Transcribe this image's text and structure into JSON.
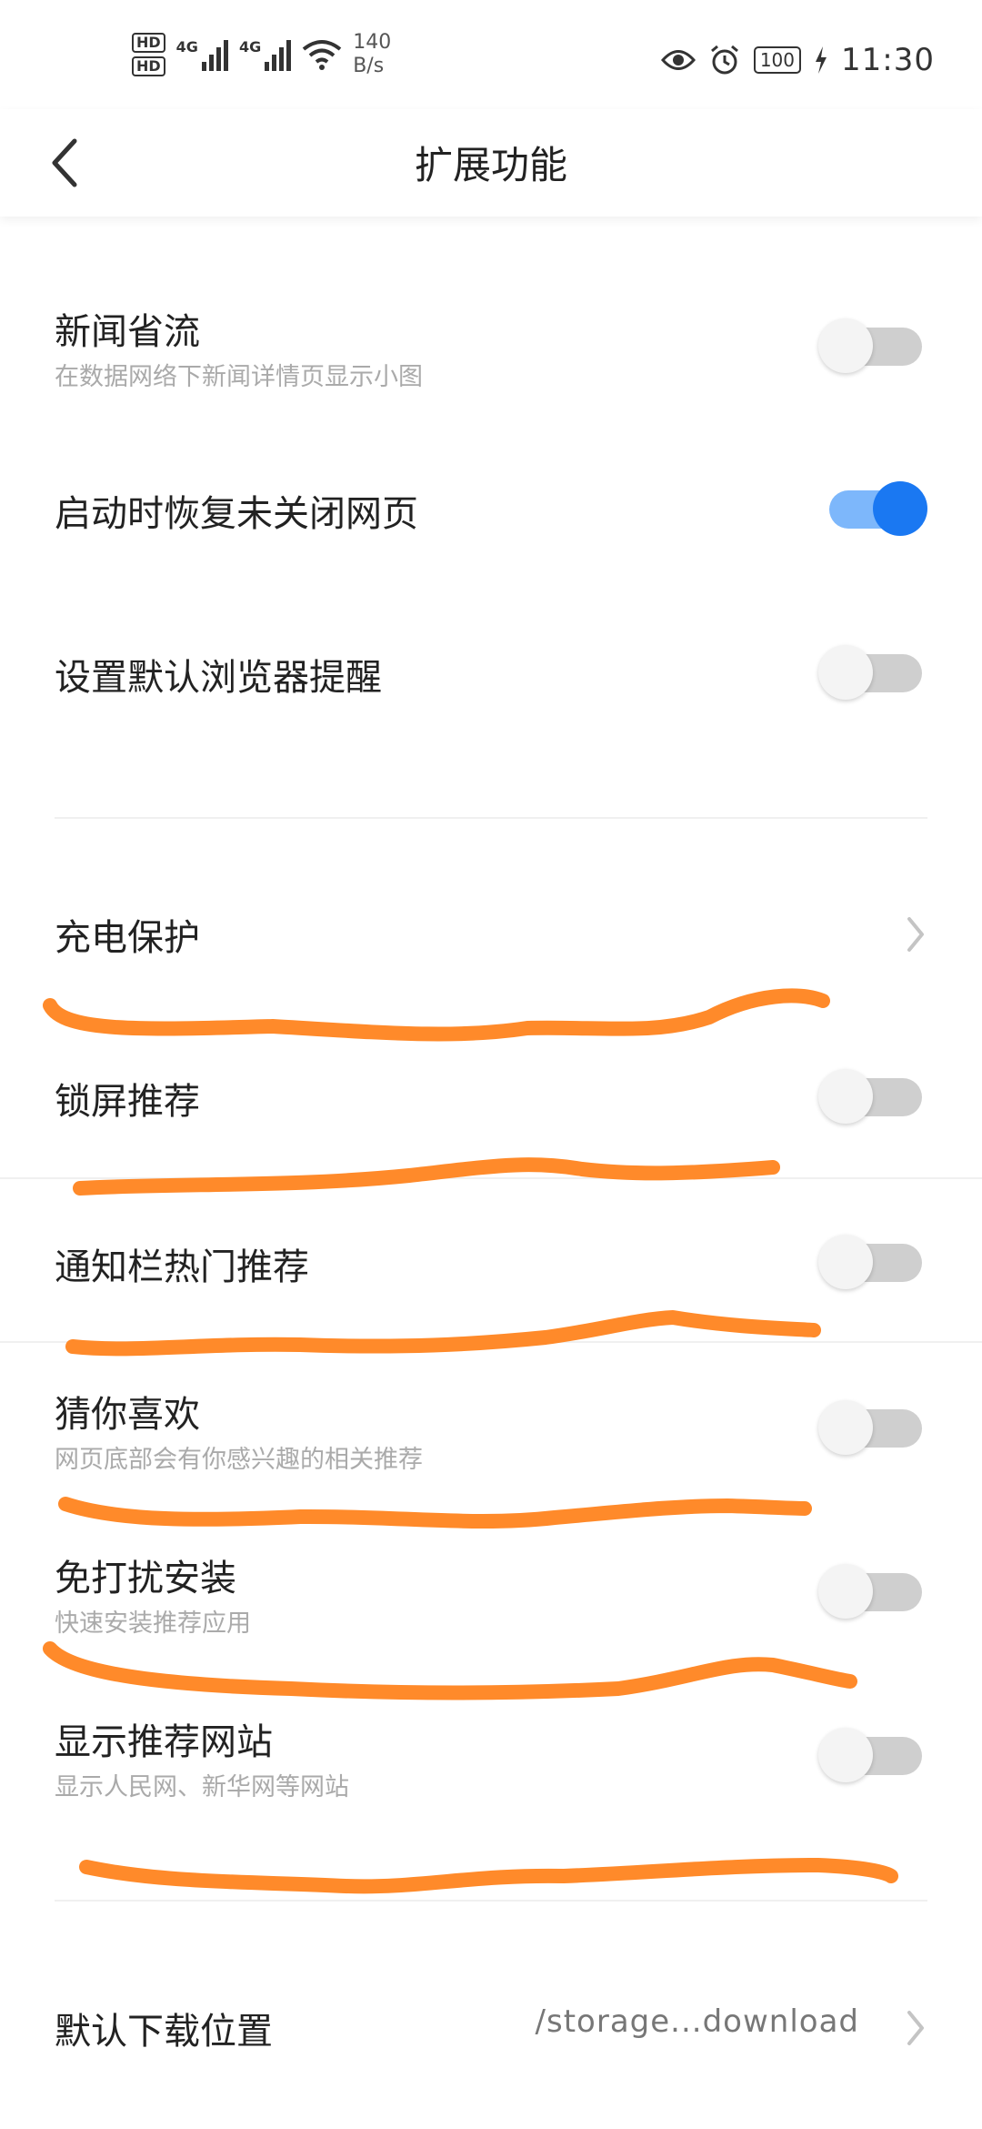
{
  "status_bar": {
    "hd1": "HD",
    "hd2": "HD",
    "sig1": "4G",
    "sig2": "4G",
    "net_speed_value": "140",
    "net_speed_unit": "B/s",
    "battery": "100",
    "time": "11:30"
  },
  "header": {
    "title": "扩展功能"
  },
  "settings": [
    {
      "label": "新闻省流",
      "sub": "在数据网络下新闻详情页显示小图",
      "on": false
    },
    {
      "label": "启动时恢复未关闭网页",
      "sub": "",
      "on": true
    },
    {
      "label": "设置默认浏览器提醒",
      "sub": "",
      "on": false
    },
    {
      "label": "充电保护",
      "sub": "",
      "type": "link"
    },
    {
      "label": "锁屏推荐",
      "sub": "",
      "on": false
    },
    {
      "label": "通知栏热门推荐",
      "sub": "",
      "on": false
    },
    {
      "label": "猜你喜欢",
      "sub": "网页底部会有你感兴趣的相关推荐",
      "on": false
    },
    {
      "label": "免打扰安装",
      "sub": "快速安装推荐应用",
      "on": false
    },
    {
      "label": "显示推荐网站",
      "sub": "显示人民网、新华网等网站",
      "on": false
    },
    {
      "label": "默认下载位置",
      "value": "/storage...download",
      "type": "link"
    }
  ],
  "colors": {
    "switch_on_knob": "#1a78f2",
    "switch_on_track": "#7db7fb",
    "switch_off_track": "#cfcfcf",
    "scribble": "#ff8a2a"
  }
}
